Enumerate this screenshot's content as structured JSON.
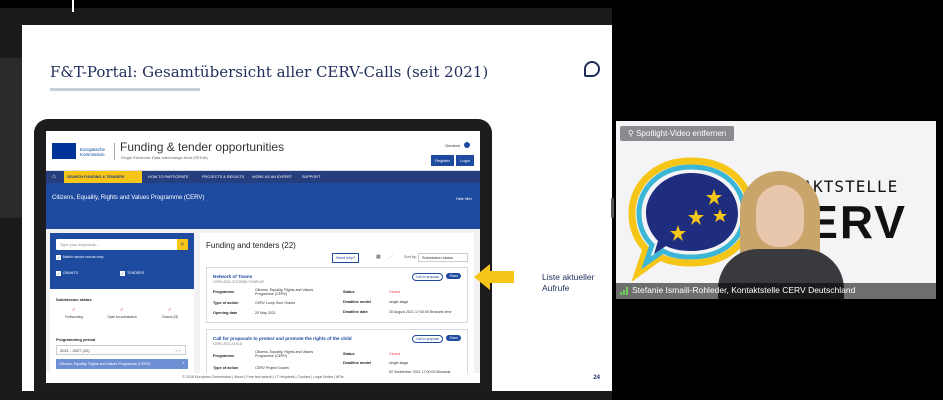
{
  "slide": {
    "title": "F&T-Portal: Gesamtübersicht aller CERV-Calls (seit 2021)",
    "page_number": "24",
    "callout": [
      "Liste aktueller",
      "Aufrufe"
    ]
  },
  "portal": {
    "eu_logo_text": [
      "Europäische",
      "Kommission"
    ],
    "brand": "Funding & tender opportunities",
    "brand_sub": "Single Electronic Data Interchange Area (SEDIA)",
    "language": "Deutsch",
    "register": "Register",
    "login": "Login",
    "nav": {
      "active": "SEARCH FUNDING & TENDERS",
      "items": [
        "HOW TO PARTICIPATE",
        "PROJECTS & RESULTS",
        "WORK AS AN EXPERT",
        "SUPPORT"
      ]
    },
    "hero_title": "Citizens, Equality, Rights and Values Programme (CERV)",
    "hero_link": "Hide filter",
    "search_placeholder": "Type your keywords...",
    "match_label": "Match whole words only",
    "types": [
      "GRANTS",
      "TENDERS"
    ],
    "submission_status": "Submission status",
    "statuses": [
      "Forthcoming",
      "Open for submission",
      "Closed (23)"
    ],
    "programming_period": "Programming period",
    "period_value": "2021 - 2027 (22)",
    "programme_tag": "Citizens, Equality, Rights and Values Programme (CERV)",
    "results_title": "Funding and tenders (22)",
    "need_help": "Need help?",
    "sort_by": "Sort by:",
    "sort_value": "Submission status",
    "cards": [
      {
        "title": "Network of Towns",
        "sub": "CERV-2021-CITIZENS-TOWN-NT",
        "cfp": "Call for proposal",
        "share": "Share",
        "programme_label": "Programme",
        "programme": [
          "Citizens, Equality, Rights and Values",
          "Programme (CERV)"
        ],
        "action_label": "Type of action",
        "action": "CERV Lump Sum Grants",
        "opening_label": "Opening date",
        "opening": "20 May 2021",
        "status_label": "Status",
        "status": "Closed",
        "deadline_model_label": "Deadline model",
        "deadline_model": "single-stage",
        "deadline_date_label": "Deadline date",
        "deadline_date": "30 August 2021 17:00:00 Brussels time"
      },
      {
        "title": "Call for proposals to protect and promote the rights of the child",
        "sub": "CERV-2021-CHILD",
        "cfp": "Call for proposal",
        "share": "Share",
        "programme_label": "Programme",
        "programme": [
          "Citizens, Equality, Rights and Values",
          "Programme (CERV)"
        ],
        "action_label": "Type of action",
        "action": "CERV Project Grants",
        "status_label": "Status",
        "status": "Closed",
        "deadline_model_label": "Deadline model",
        "deadline_model": "single-stage",
        "deadline_date": "02 September 2021 17:00:00 Brussels"
      }
    ],
    "footer": "© 2018 European Commission | About | Free text search | IT Helpdesk | Cookies | Legal Notice | APIs"
  },
  "video": {
    "spotlight_label": "Spotlight-Video entfernen",
    "logo_line1": "KONTAKTSTELLE",
    "logo_line2": "CERV",
    "participant_name": "Stefanie Ismaili-Rohleder, Kontaktstelle CERV Deutschland"
  }
}
